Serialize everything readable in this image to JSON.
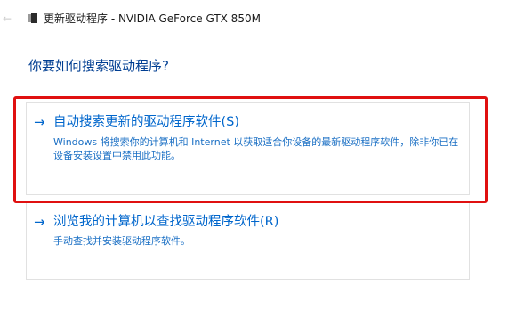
{
  "titlebar": {
    "back_icon": "back-arrow-icon",
    "device_icon": "device-icon",
    "title": "更新驱动程序 - NVIDIA GeForce GTX 850M"
  },
  "main": {
    "heading": "你要如何搜索驱动程序?",
    "options": [
      {
        "arrow": "→",
        "title": "自动搜索更新的驱动程序软件(S)",
        "description": "Windows 将搜索你的计算机和 Internet 以获取适合你设备的最新驱动程序软件，除非你已在设备安装设置中禁用此功能。"
      },
      {
        "arrow": "→",
        "title": "浏览我的计算机以查找驱动程序软件(R)",
        "description": "手动查找并安装驱动程序软件。"
      }
    ]
  },
  "annotation": {
    "highlight_color": "#e01010"
  },
  "colors": {
    "link": "#0066cc",
    "heading": "#003e92",
    "card_border": "#e1e1e1"
  }
}
